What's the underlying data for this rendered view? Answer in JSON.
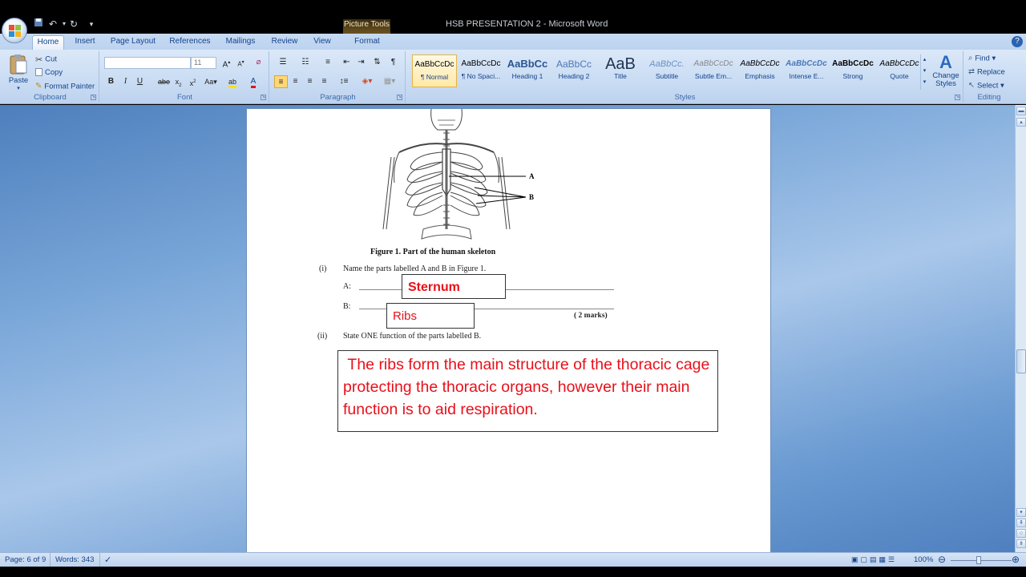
{
  "window": {
    "title": "HSB PRESENTATION 2 - Microsoft Word",
    "contextual_tab_group": "Picture Tools"
  },
  "tabs": [
    "Home",
    "Insert",
    "Page Layout",
    "References",
    "Mailings",
    "Review",
    "View",
    "Format"
  ],
  "ribbon": {
    "clipboard": {
      "label": "Clipboard",
      "paste": "Paste",
      "cut": "Cut",
      "copy": "Copy",
      "format_painter": "Format Painter"
    },
    "font": {
      "label": "Font",
      "font_name": "",
      "font_size": "11"
    },
    "paragraph": {
      "label": "Paragraph"
    },
    "styles": {
      "label": "Styles",
      "items": [
        {
          "sample": "AaBbCcDc",
          "name": "¶ Normal"
        },
        {
          "sample": "AaBbCcDc",
          "name": "¶ No Spaci..."
        },
        {
          "sample": "AaBbCc",
          "name": "Heading 1"
        },
        {
          "sample": "AaBbCc",
          "name": "Heading 2"
        },
        {
          "sample": "AaB",
          "name": "Title"
        },
        {
          "sample": "AaBbCc.",
          "name": "Subtitle"
        },
        {
          "sample": "AaBbCcDc",
          "name": "Subtle Em..."
        },
        {
          "sample": "AaBbCcDc",
          "name": "Emphasis"
        },
        {
          "sample": "AaBbCcDc",
          "name": "Intense E..."
        },
        {
          "sample": "AaBbCcDc",
          "name": "Strong"
        },
        {
          "sample": "AaBbCcDc",
          "name": "Quote"
        }
      ],
      "change_styles": "Change Styles"
    },
    "editing": {
      "label": "Editing",
      "find": "Find",
      "replace": "Replace",
      "select": "Select"
    }
  },
  "document": {
    "label_a": "A",
    "label_b": "B",
    "figure_caption": "Figure 1.  Part of the human skeleton",
    "q1_num": "(i)",
    "q1_text": "Name the parts labelled A and B in Figure 1.",
    "a_label": "A:",
    "b_label": "B:",
    "answer_a": "Sternum",
    "answer_b": "Ribs",
    "marks": "(  2 marks)",
    "q2_num": "(ii)",
    "q2_text": "State ONE function of the parts labelled B.",
    "answer_2": " The ribs form the main structure of the thoracic cage protecting the thoracic organs, however their main function is to aid respiration."
  },
  "status": {
    "page": "Page: 6 of 9",
    "words": "Words: 343",
    "zoom": "100%"
  },
  "colors": {
    "answer_red": "#e8101a",
    "ribbon_blue": "#c9dcf3",
    "workspace_blue": "#7aa7d9"
  }
}
